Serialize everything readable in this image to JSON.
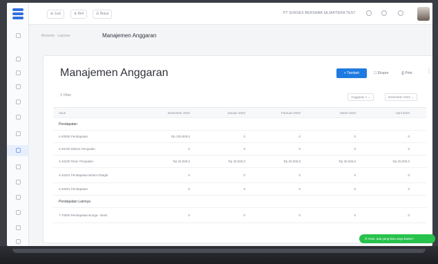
{
  "colors": {
    "accent": "#1f7ae0",
    "chat": "#27c24c",
    "text": "#2f333b"
  },
  "topbar": {
    "pills": [
      "⊕ Jual",
      "⊕ Beli",
      "☰ Biaya"
    ],
    "company": "PT SUKSES BERSAMA SEJAHTERA TEST",
    "icons": [
      "help-icon",
      "settings-icon",
      "notification-icon"
    ]
  },
  "breadcrumb": {
    "items": [
      "Beranda",
      "Laporan"
    ],
    "current": "Manajemen Anggaran"
  },
  "page": {
    "title": "Manajemen Anggaran",
    "new_button": "+ Tambah",
    "export_button": "Ekspor",
    "print_button": "Print",
    "filter_label": "Filter",
    "budget_select": "Anggaran 1",
    "period_select": "Desember 2022"
  },
  "table": {
    "headers": [
      "Akun",
      "Desember 2022",
      "Januari 2023",
      "Februari 2023",
      "Maret 2023",
      "April 2023"
    ],
    "rows": [
      {
        "type": "section",
        "cells": [
          "Pendapatan",
          "",
          "",
          "",
          "",
          ""
        ]
      },
      {
        "type": "data",
        "cells": [
          "4-40000 Pendapatan",
          "Rp 100.000,0",
          "0",
          "0",
          "0",
          "0"
        ]
      },
      {
        "type": "data",
        "cells": [
          "4-40100 Diskon Penjualan",
          "0",
          "0",
          "0",
          "0",
          "0"
        ]
      },
      {
        "type": "data",
        "cells": [
          "4-40200 Retur Penjualan",
          "Rp 20.000,0",
          "Rp 20.000,0",
          "Rp 20.000,0",
          "Rp 20.000,0",
          "Rp 20.000,0"
        ]
      },
      {
        "type": "tall",
        "cells": [
          "4-40201 Pendapatan Belum Ditagih",
          "0",
          "0",
          "0",
          "0",
          "0"
        ]
      },
      {
        "type": "data",
        "cells": [
          "4-40001 Pendapatan",
          "0",
          "0",
          "0",
          "0",
          "0"
        ]
      },
      {
        "type": "section",
        "cells": [
          "Pendapatan Lainnya",
          "",
          "",
          "",
          "",
          ""
        ]
      },
      {
        "type": "tall",
        "cells": [
          "7-70000 Pendapatan Bunga - Bank",
          "0",
          "0",
          "0",
          "0",
          "0"
        ]
      }
    ]
  },
  "chat": {
    "label": "Halo, ada yang bisa saya bantu?"
  }
}
